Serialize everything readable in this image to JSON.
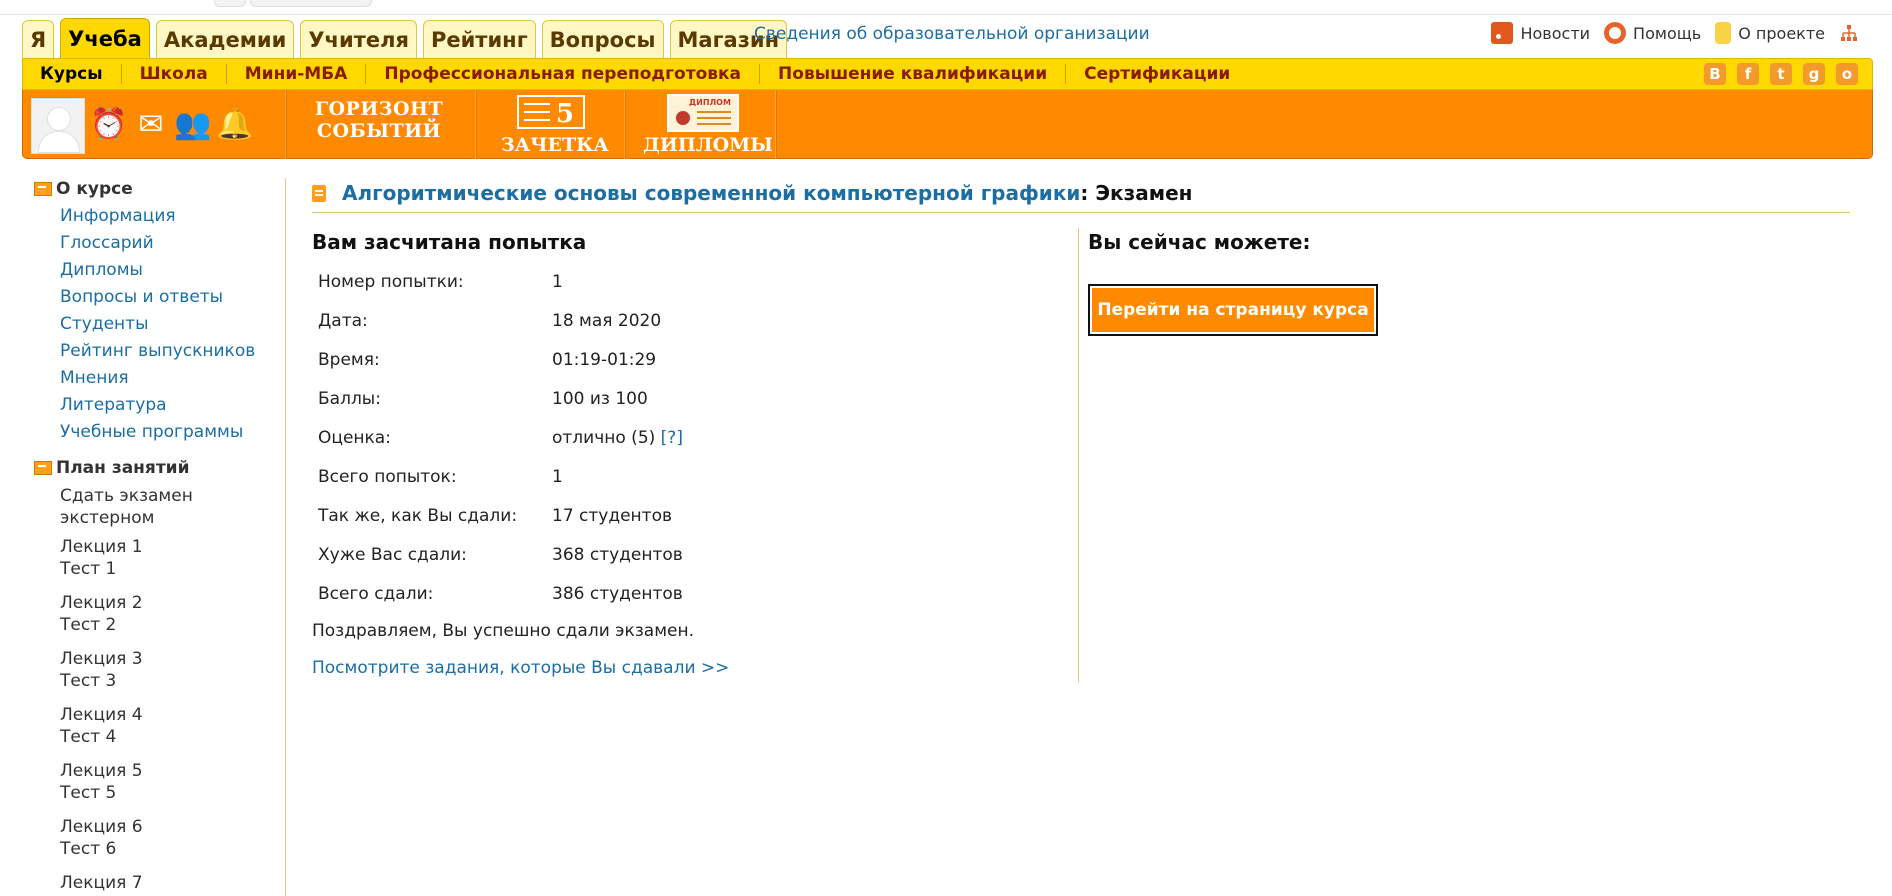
{
  "tabs": [
    {
      "label": "Я",
      "active": false
    },
    {
      "label": "Учеба",
      "active": true
    },
    {
      "label": "Академии",
      "active": false
    },
    {
      "label": "Учителя",
      "active": false
    },
    {
      "label": "Рейтинг",
      "active": false
    },
    {
      "label": "Вопросы",
      "active": false
    },
    {
      "label": "Магазин",
      "active": false
    }
  ],
  "header": {
    "org_link": "Сведения об образовательной организации",
    "right_links": {
      "news": "Новости",
      "help": "Помощь",
      "about": "О проекте"
    }
  },
  "menubar": {
    "items": [
      "Курсы",
      "Школа",
      "Мини-МБА",
      "Профессиональная переподготовка",
      "Повышение квалификации",
      "Сертификации"
    ],
    "socials": [
      "В",
      "f",
      "t",
      "g",
      "о"
    ]
  },
  "toolbar": {
    "horizon": {
      "line1": "ГОРИЗОНТ",
      "line2": "СОБЫТИЙ"
    },
    "zachetka": {
      "num": "5",
      "label": "ЗАЧЕТКА"
    },
    "diplomas": {
      "top": "ДИПЛОМ",
      "label": "ДИПЛОМЫ"
    }
  },
  "sidebar": {
    "about_title": "О курсе",
    "about_links": [
      "Информация",
      "Глоссарий",
      "Дипломы",
      "Вопросы и ответы",
      "Студенты",
      "Рейтинг выпускников",
      "Мнения",
      "Литература",
      "Учебные программы"
    ],
    "plan_title": "План занятий",
    "plan": [
      {
        "a": "Сдать экзамен",
        "b": "экстерном"
      },
      {
        "a": "Лекция 1",
        "b": "Тест 1"
      },
      {
        "a": "Лекция 2",
        "b": "Тест 2"
      },
      {
        "a": "Лекция 3",
        "b": "Тест 3"
      },
      {
        "a": "Лекция 4",
        "b": "Тест 4"
      },
      {
        "a": "Лекция 5",
        "b": "Тест 5"
      },
      {
        "a": "Лекция 6",
        "b": "Тест 6"
      },
      {
        "a": "Лекция 7",
        "b": ""
      }
    ]
  },
  "main": {
    "course_link": "Алгоритмические основы современной компьютерной графики",
    "course_suffix": ": Экзамен",
    "attempt_title": "Вам засчитана попытка",
    "rows": [
      {
        "k": "Номер попытки:",
        "v": "1"
      },
      {
        "k": "Дата:",
        "v": "18 мая 2020"
      },
      {
        "k": "Время:",
        "v": "01:19-01:29"
      },
      {
        "k": "Баллы:",
        "v": "100 из 100"
      },
      {
        "k": "Оценка:",
        "v": "отлично (5)"
      },
      {
        "k": "Всего попыток:",
        "v": "1"
      },
      {
        "k": "Так же, как Вы сдали:",
        "v": "17 студентов"
      },
      {
        "k": "Хуже Вас сдали:",
        "v": "368 студентов"
      },
      {
        "k": "Всего сдали:",
        "v": "386 студентов"
      }
    ],
    "grade_hint": "[?]",
    "congrats": "Поздравляем, Вы успешно сдали экзамен.",
    "view_link": "Посмотрите задания, которые Вы сдавали >>",
    "now_title": "Вы сейчас можете:",
    "go_button": "Перейти на страницу курса"
  },
  "colors": {
    "accent_orange": "#ff8a00",
    "menu_yellow": "#ffd800",
    "link_blue": "#1a6ea3"
  }
}
